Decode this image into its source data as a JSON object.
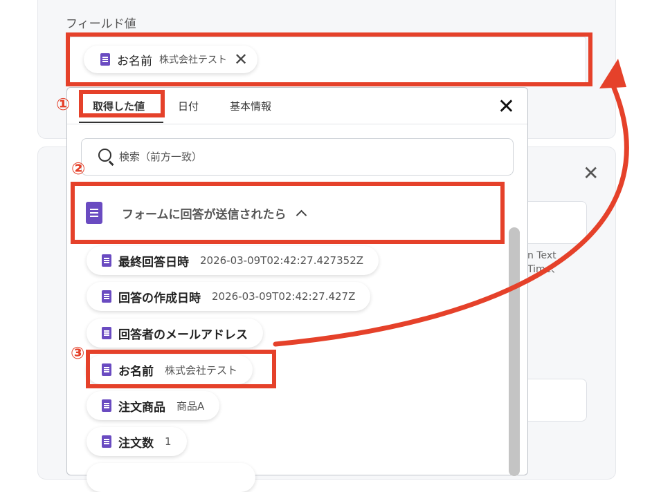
{
  "field_section": {
    "label": "フィールド値",
    "selected_chip": {
      "name": "お名前",
      "value": "株式会社テスト"
    }
  },
  "tabs": [
    {
      "label": "取得した値",
      "active": true
    },
    {
      "label": "日付",
      "active": false
    },
    {
      "label": "基本情報",
      "active": false
    }
  ],
  "search": {
    "placeholder": "検索（前方一致）"
  },
  "group": {
    "title": "フォームに回答が送信されたら"
  },
  "items": [
    {
      "name": "最終回答日時",
      "value": "2026-03-09T02:42:27.427352Z"
    },
    {
      "name": "回答の作成日時",
      "value": "2026-03-09T02:42:27.427Z"
    },
    {
      "name": "回答者のメールアドレス",
      "value": ""
    },
    {
      "name": "お名前",
      "value": "株式会社テスト"
    },
    {
      "name": "注文商品",
      "value": "商品A"
    },
    {
      "name": "注文数",
      "value": "1"
    }
  ],
  "background_text": "n Text\nTime、",
  "annotations": {
    "one": "①",
    "two": "②",
    "three": "③"
  },
  "icons": {
    "form_icon": "google-forms-doc-icon",
    "close": "close-icon",
    "search": "search-icon",
    "caret": "chevron-up-icon"
  },
  "colors": {
    "accent": "#e5412a",
    "form_icon": "#6a4bc1"
  }
}
